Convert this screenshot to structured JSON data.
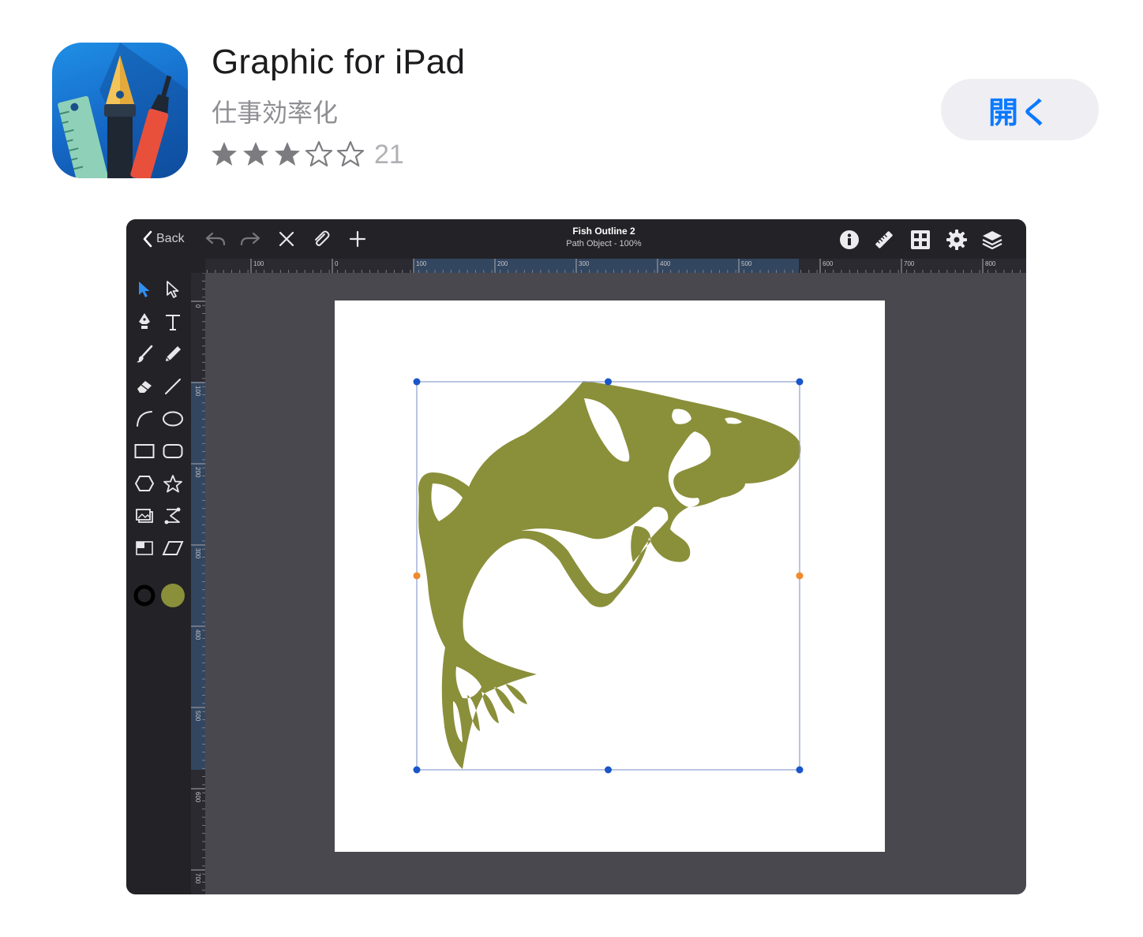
{
  "app": {
    "title": "Graphic for iPad",
    "category": "仕事効率化",
    "rating": 3,
    "rating_max": 5,
    "rating_count": "21",
    "open_label": "開く",
    "accent_color": "#0a7aff"
  },
  "editor": {
    "back_label": "Back",
    "document_title": "Fish Outline 2",
    "document_subtitle": "Path Object - 100%",
    "toolbar_left_icons": [
      "back-chevron-icon",
      "undo-icon",
      "redo-icon",
      "delete-icon",
      "attachment-icon",
      "add-icon"
    ],
    "toolbar_right_icons": [
      "info-icon",
      "ruler-icon",
      "grid-icon",
      "gear-icon",
      "layers-icon"
    ],
    "ruler_top_labels": [
      "100",
      "0",
      "100",
      "200",
      "300",
      "400",
      "500",
      "600",
      "700",
      "800"
    ],
    "ruler_left_labels": [
      "0",
      "100",
      "200",
      "300",
      "400",
      "500",
      "600",
      "700"
    ],
    "tools": [
      "select-arrow-icon",
      "direct-select-icon",
      "pen-tool-icon",
      "text-tool-icon",
      "brush-icon",
      "pencil-icon",
      "eraser-icon",
      "line-icon",
      "arc-icon",
      "ellipse-icon",
      "rectangle-icon",
      "rounded-rectangle-icon",
      "polygon-icon",
      "star-icon",
      "image-import-icon",
      "transform-icon",
      "shape-builder-icon",
      "skew-icon"
    ],
    "stroke_color": "#000000",
    "fill_color": "#8a8f3a",
    "selection_color": "#1a56c9",
    "midpoint_handle_color": "#f08a2c"
  }
}
